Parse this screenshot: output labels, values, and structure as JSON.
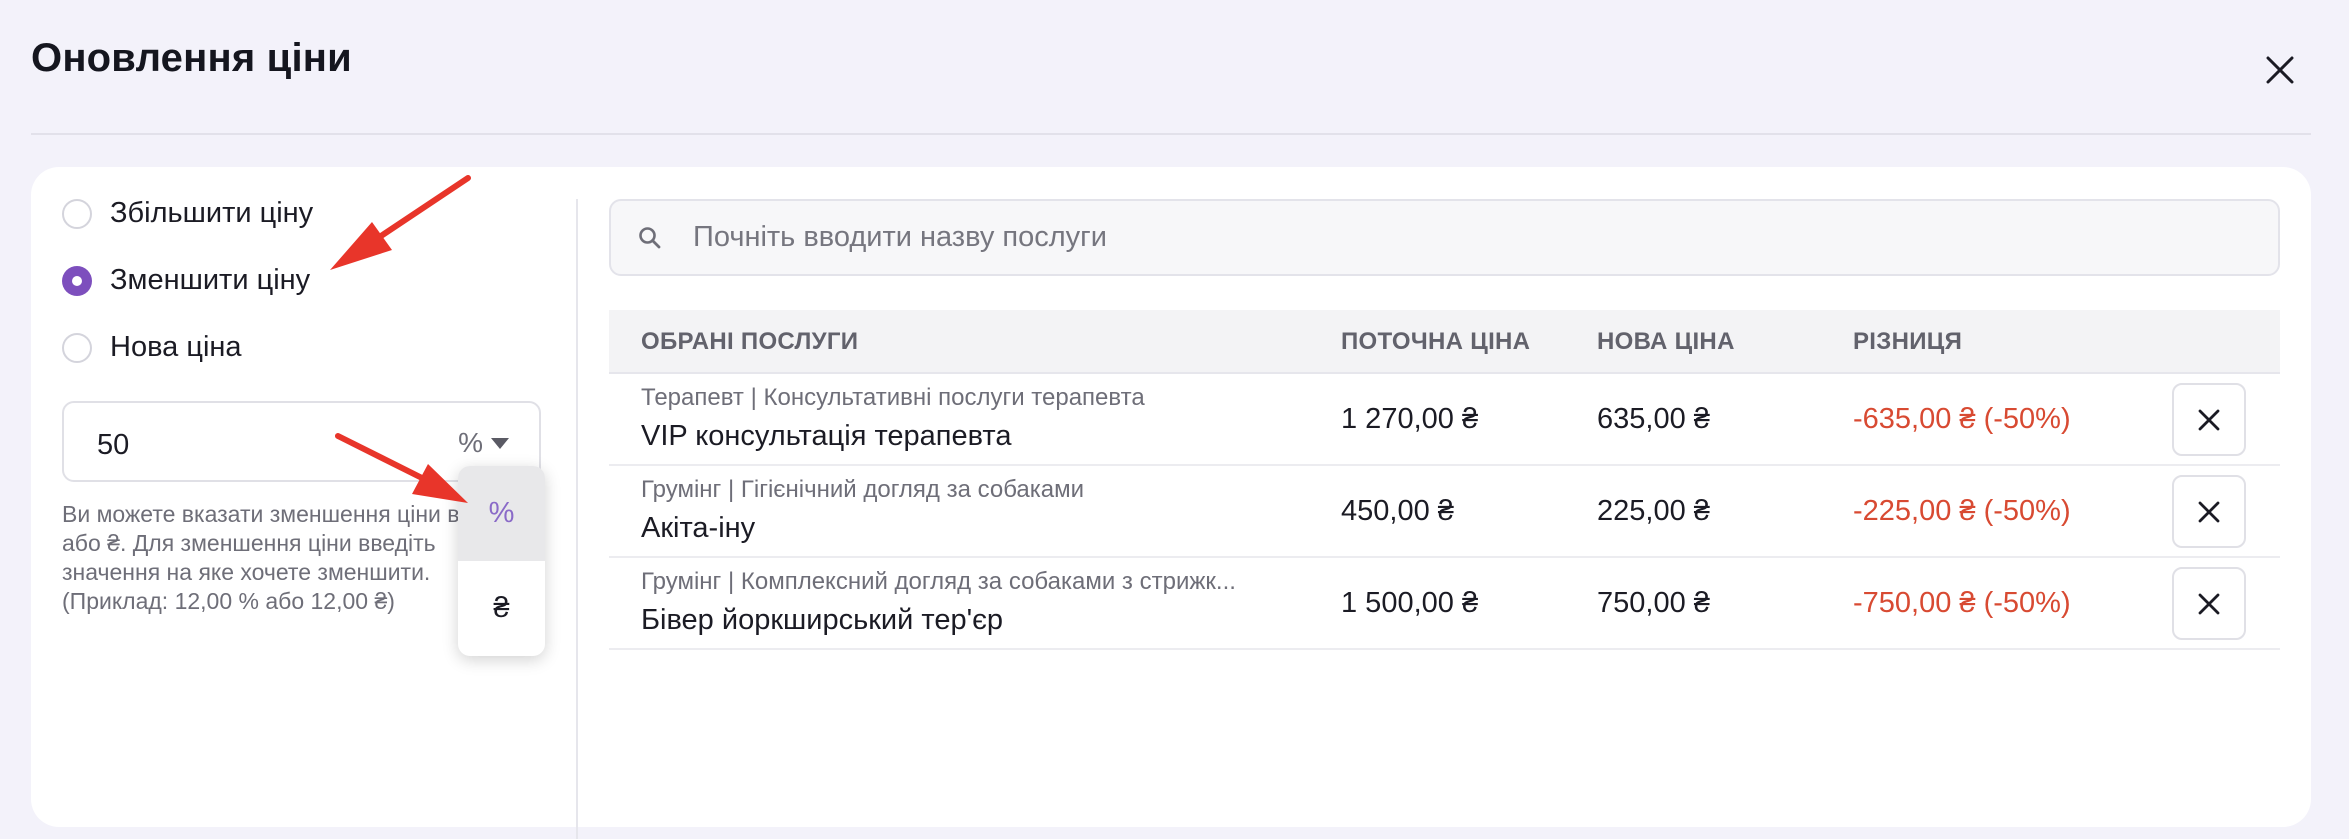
{
  "modal": {
    "title": "Оновлення ціни"
  },
  "options": [
    {
      "label": "Збільшити ціну",
      "checked": false
    },
    {
      "label": "Зменшити ціну",
      "checked": true
    },
    {
      "label": "Нова ціна",
      "checked": false
    }
  ],
  "value_input": {
    "value": "50",
    "unit": "%"
  },
  "help_text": "Ви можете вказати зменшення ціни в % або ₴. Для зменшення ціни введіть значення на яке хочете зменшити. (Приклад: 12,00 % або 12,00 ₴)",
  "unit_dropdown": {
    "options": [
      "%",
      "₴"
    ],
    "selected": "%"
  },
  "search": {
    "placeholder": "Почніть вводити назву послуги"
  },
  "table": {
    "headers": {
      "services": "ОБРАНІ ПОСЛУГИ",
      "current": "ПОТОЧНА ЦІНА",
      "new": "НОВА ЦІНА",
      "diff": "РІЗНИЦЯ"
    },
    "rows": [
      {
        "category": "Терапевт | Консультативні послуги терапевта",
        "name": "VIP консультація терапевта",
        "current": "1 270,00 ₴",
        "new": "635,00 ₴",
        "diff": "-635,00 ₴ (-50%)"
      },
      {
        "category": "Грумінг | Гігієнічний догляд за собаками",
        "name": "Акіта-іну",
        "current": "450,00 ₴",
        "new": "225,00 ₴",
        "diff": "-225,00 ₴ (-50%)"
      },
      {
        "category": "Грумінг | Комплексний догляд за собаками з стрижк...",
        "name": "Бівер йоркширський тер'єр",
        "current": "1 500,00 ₴",
        "new": "750,00 ₴",
        "diff": "-750,00 ₴ (-50%)"
      }
    ]
  },
  "colors": {
    "accent": "#7d4fbd",
    "negative": "#d84a32",
    "annotation_arrow": "#e8352a"
  }
}
